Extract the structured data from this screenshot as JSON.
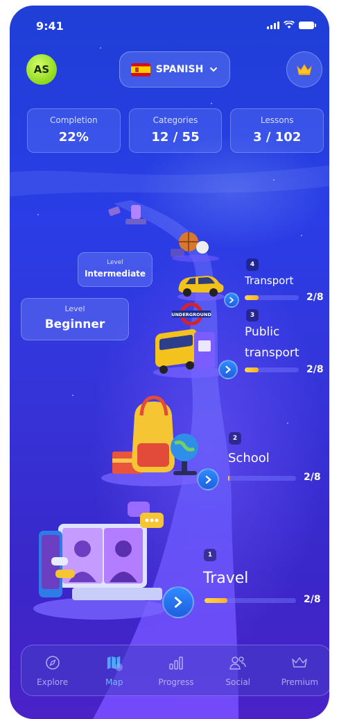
{
  "status_bar": {
    "time": "9:41"
  },
  "header": {
    "avatar_initials": "AS",
    "language_label": "SPANISH",
    "language_flag_icon": "spain-flag-icon",
    "premium_icon": "crown-icon"
  },
  "stats": [
    {
      "label": "Completion",
      "value": "22%"
    },
    {
      "label": "Categories",
      "value": "12 / 55"
    },
    {
      "label": "Lessons",
      "value": "3 / 102"
    }
  ],
  "levels": {
    "intermediate": {
      "caption": "Level",
      "name": "Intermediate"
    },
    "beginner": {
      "caption": "Level",
      "name": "Beginner"
    }
  },
  "categories": [
    {
      "number": "4",
      "name": "Transport",
      "progress_text": "2/8",
      "progress": 0.25
    },
    {
      "number": "3",
      "name_line1": "Public",
      "name_line2": "transport",
      "progress_text": "2/8",
      "progress": 0.25
    },
    {
      "number": "2",
      "name": "School",
      "progress_text": "2/8",
      "progress": 0.02
    },
    {
      "number": "1",
      "name": "Travel",
      "progress_text": "2/8",
      "progress": 0.25
    }
  ],
  "illustrations": {
    "transport_sign": "UNDERGROUND"
  },
  "nav": [
    {
      "label": "Explore",
      "icon": "compass-icon",
      "active": false
    },
    {
      "label": "Map",
      "icon": "map-icon",
      "active": true
    },
    {
      "label": "Progress",
      "icon": "bar-chart-icon",
      "active": false
    },
    {
      "label": "Social",
      "icon": "people-icon",
      "active": false
    },
    {
      "label": "Premium",
      "icon": "crown-outline-icon",
      "active": false
    }
  ],
  "colors": {
    "accent_blue": "#2e8bff",
    "progress_yellow": "#ffc83a",
    "avatar_green": "#9be22a",
    "active_nav": "#6fb8ff"
  }
}
